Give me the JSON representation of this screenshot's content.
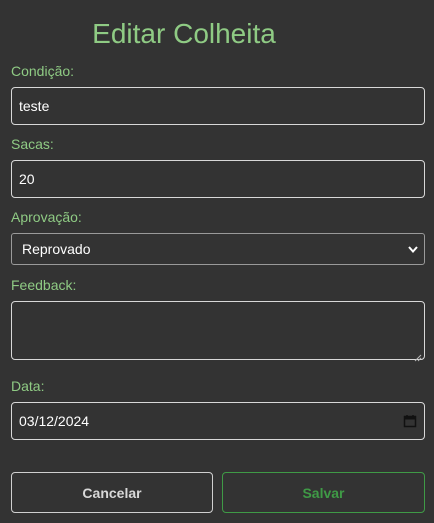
{
  "form": {
    "title": "Editar Colheita",
    "condicao": {
      "label": "Condição:",
      "value": "teste"
    },
    "sacas": {
      "label": "Sacas:",
      "value": "20"
    },
    "aprovacao": {
      "label": "Aprovação:",
      "selected": "Reprovado"
    },
    "feedback": {
      "label": "Feedback:",
      "value": ""
    },
    "data": {
      "label": "Data:",
      "value": "03/12/2024"
    }
  },
  "buttons": {
    "cancel_label": "Cancelar",
    "save_label": "Salvar"
  },
  "icons": {
    "select_arrow": "chevron-down-icon",
    "date_picker": "calendar-icon",
    "resize": "resize-grip-icon"
  },
  "colors": {
    "background": "#333333",
    "accent_green": "#8fcb84",
    "save_green": "#3f9a46",
    "field_border": "#d8d8d8"
  }
}
